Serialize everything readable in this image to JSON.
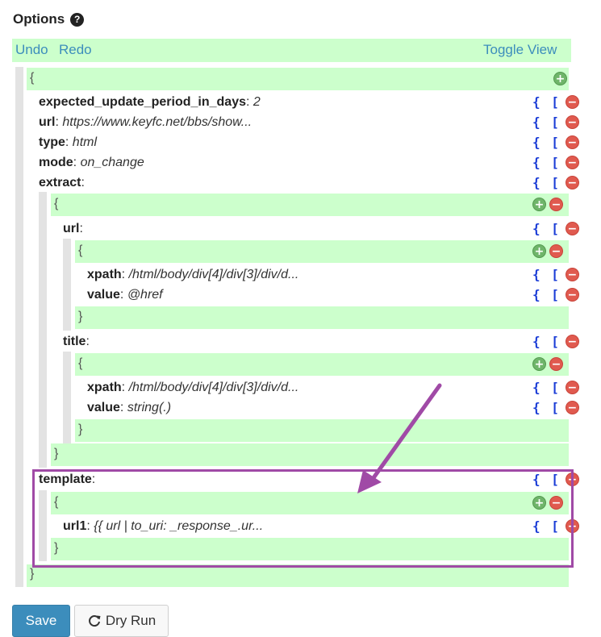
{
  "panel": {
    "title": "Options",
    "help_icon": "question-circle-icon"
  },
  "toolbar": {
    "undo": "Undo",
    "redo": "Redo",
    "toggle_view": "Toggle View"
  },
  "editor": {
    "open_brace": "{",
    "close_brace": "}",
    "add_symbol": "+",
    "remove_symbol": "−",
    "brackets": "{ [",
    "fields": {
      "expected_update_period_in_days": {
        "key": "expected_update_period_in_days",
        "value": "2"
      },
      "url": {
        "key": "url",
        "value": "https://www.keyfc.net/bbs/show..."
      },
      "type": {
        "key": "type",
        "value": "html"
      },
      "mode": {
        "key": "mode",
        "value": "on_change"
      },
      "extract": {
        "key": "extract"
      }
    },
    "extract": {
      "url": {
        "key": "url",
        "xpath": {
          "key": "xpath",
          "value": "/html/body/div[4]/div[3]/div/d..."
        },
        "value": {
          "key": "value",
          "value": "@href"
        }
      },
      "title": {
        "key": "title",
        "xpath": {
          "key": "xpath",
          "value": "/html/body/div[4]/div[3]/div/d..."
        },
        "value": {
          "key": "value",
          "value": "string(.)"
        }
      }
    },
    "template": {
      "key": "template",
      "url1": {
        "key": "url1",
        "value": "{{ url | to_uri: _response_.ur..."
      }
    }
  },
  "annotation": {
    "highlight_color": "#a04aa6"
  },
  "actions": {
    "save": "Save",
    "dry_run": "Dry Run",
    "dry_run_icon": "refresh-icon"
  },
  "colors": {
    "accent": "#3c8dbc",
    "row_bg": "#ccffcc",
    "bracket": "#1a3cd6",
    "remove": "#e05a4f",
    "add": "#6fb56a"
  }
}
